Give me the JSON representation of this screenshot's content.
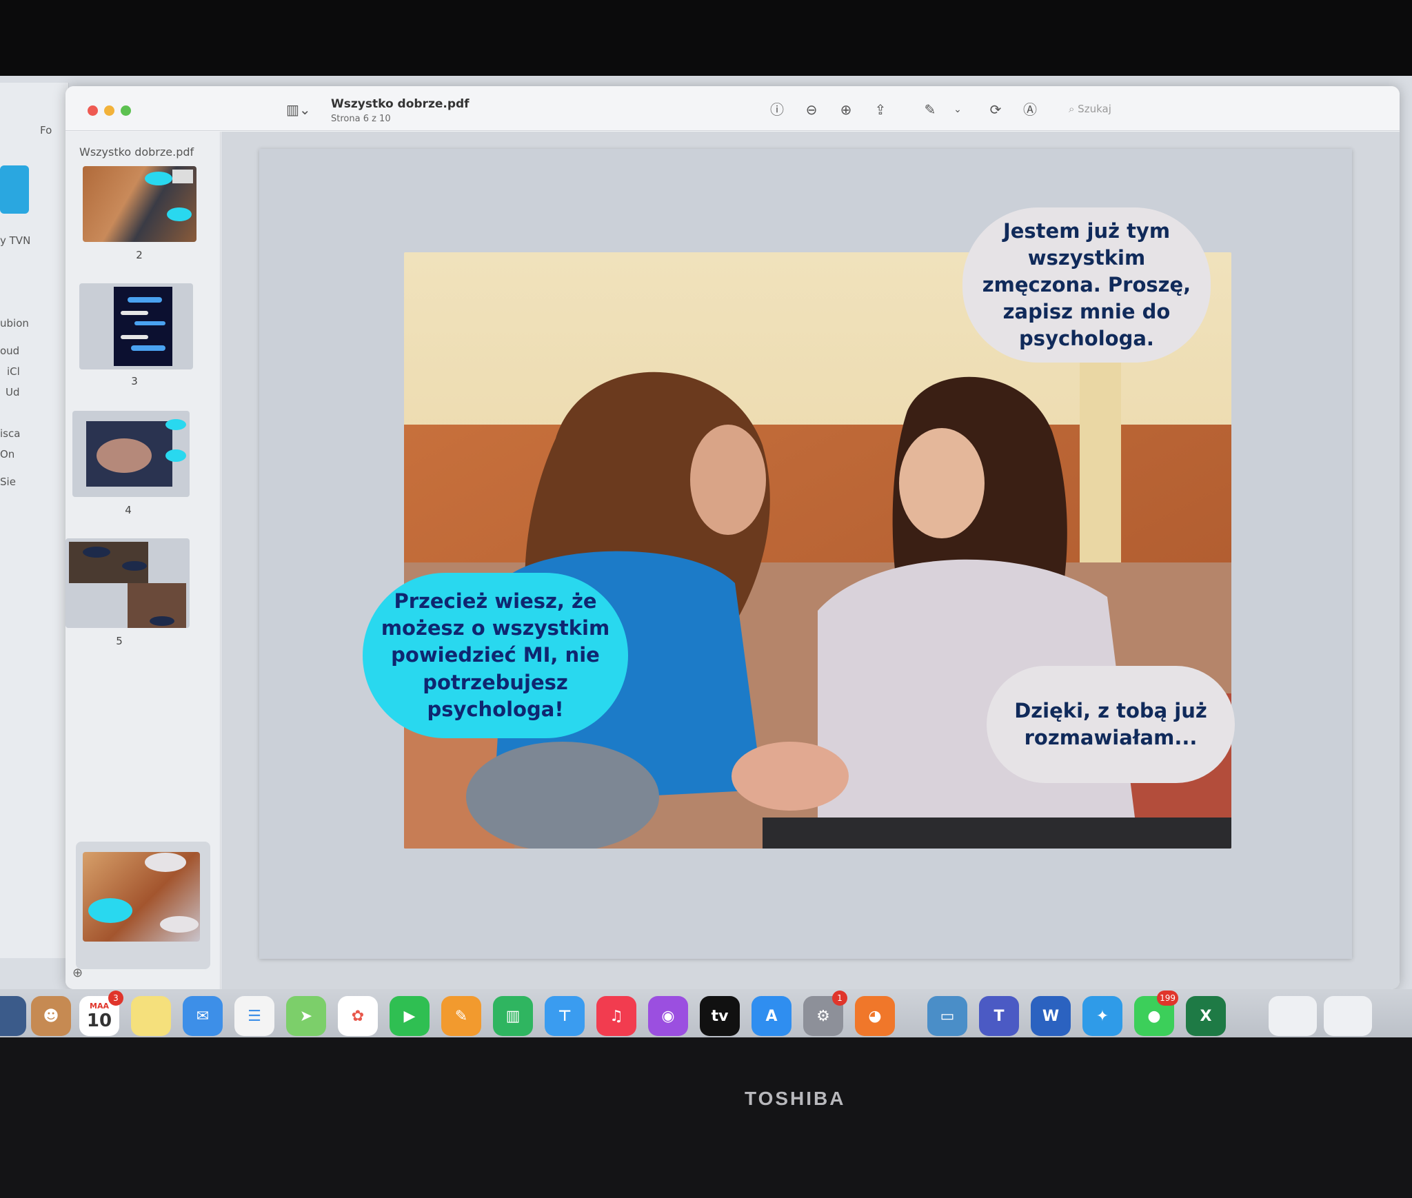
{
  "window": {
    "doc_title": "Wszystko dobrze.pdf",
    "doc_subtitle": "Strona 6 z 10",
    "search_placeholder": "Szukaj"
  },
  "sidebar": {
    "title": "Wszystko dobrze.pdf",
    "pages": [
      {
        "num": "2"
      },
      {
        "num": "3"
      },
      {
        "num": "4"
      },
      {
        "num": "5"
      },
      {
        "num": ""
      }
    ]
  },
  "background_window": {
    "labels": [
      "Fo",
      "y TVN",
      "ubion",
      "oud",
      "iCl",
      "Ud",
      "isca",
      "On",
      "Sie"
    ]
  },
  "slide": {
    "bubble_top": "Jestem już tym wszystkim zmęczona. Proszę, zapisz mnie do psychologa.",
    "bubble_left": "Przecież wiesz, że możesz o wszystkim powiedzieć MI, nie potrzebujesz psychologa!",
    "bubble_right": "Dzięki, z tobą już rozmawiałam..."
  },
  "dock": {
    "calendar_month": "MAA",
    "calendar_day": "10",
    "calendar_badge": "3",
    "settings_badge": "1",
    "messages_badge": "199",
    "tv_label": "tv",
    "word_label": "W",
    "excel_label": "X"
  },
  "device": {
    "brand": "TOSHIBA"
  },
  "colors": {
    "bubble_cyan": "#29d8ef",
    "bubble_grey": "#e6e3e6",
    "bubble_text": "#102a5a"
  }
}
